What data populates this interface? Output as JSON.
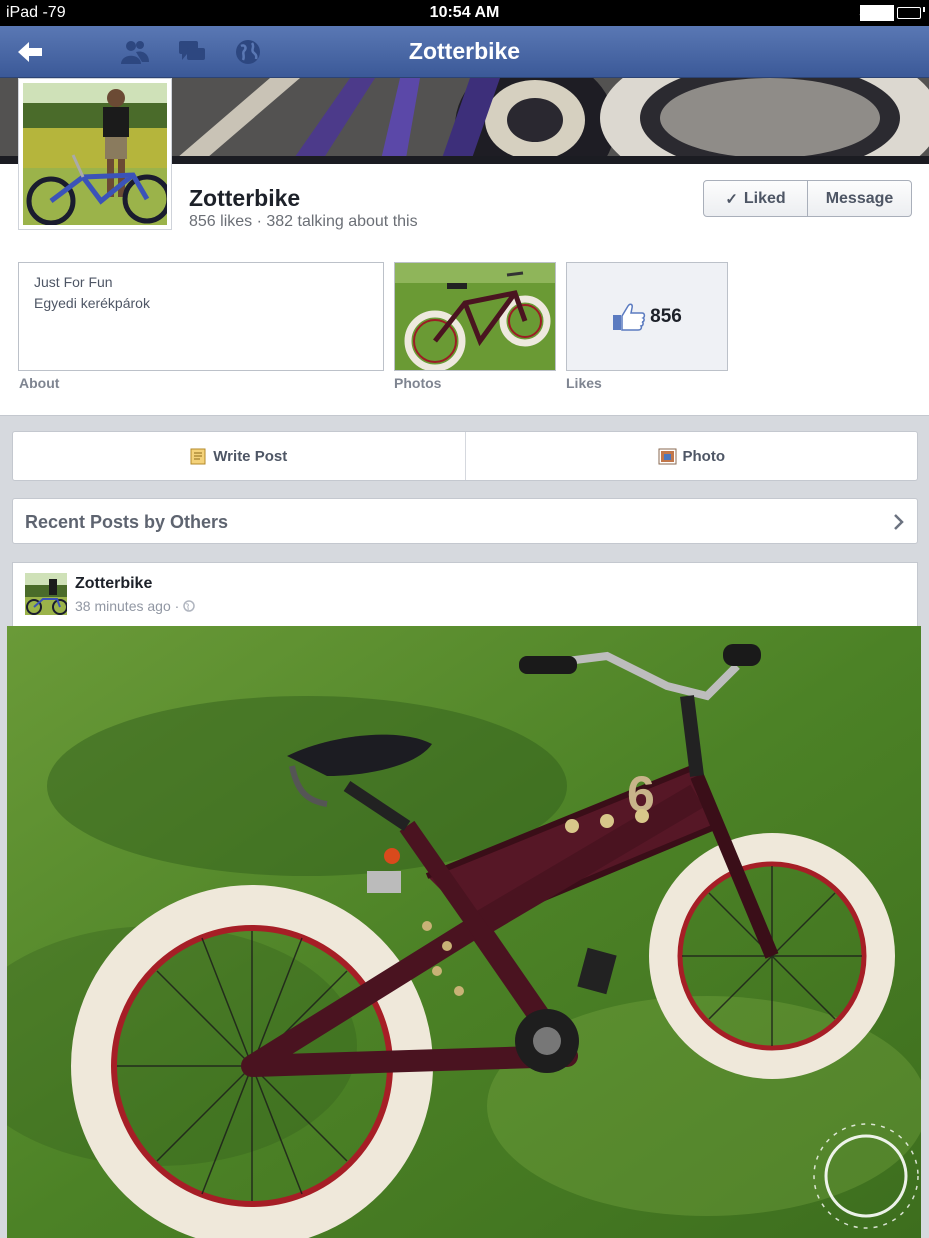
{
  "status_bar": {
    "carrier": "iPad -79",
    "time": "10:54 AM",
    "battery": "55%"
  },
  "nav": {
    "title": "Zotterbike",
    "icons": [
      "back-arrow-icon",
      "friends-icon",
      "messages-icon",
      "globe-icon"
    ]
  },
  "page": {
    "name": "Zotterbike",
    "stats": "856 likes · 382 talking about this",
    "liked_label": "Liked",
    "message_label": "Message"
  },
  "about": {
    "line1": "Just For Fun",
    "line2": "Egyedi kerékpárok",
    "label": "About"
  },
  "photos": {
    "label": "Photos"
  },
  "likes": {
    "count": "856",
    "label": "Likes"
  },
  "actions": {
    "write_post": "Write Post",
    "photo": "Photo"
  },
  "recent": {
    "title": "Recent Posts by Others"
  },
  "post": {
    "author": "Zotterbike",
    "time": "38 minutes ago ·"
  },
  "colors": {
    "brand": "#3b5998",
    "background": "#d6d9de"
  }
}
